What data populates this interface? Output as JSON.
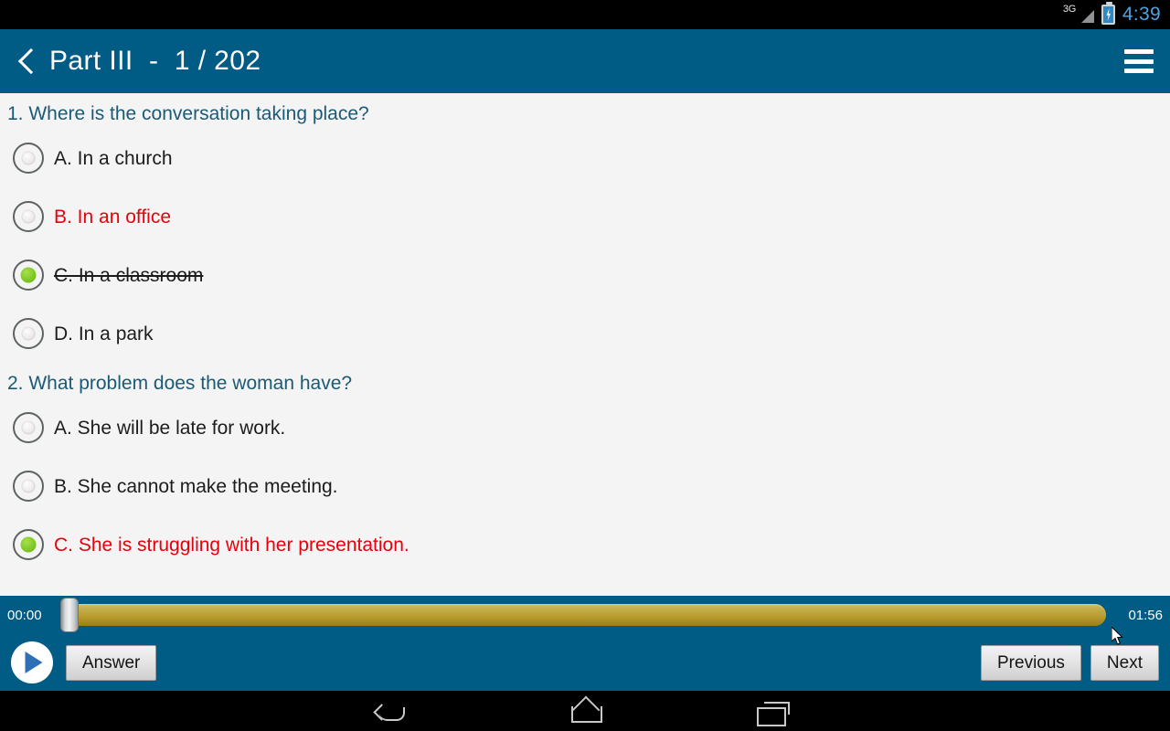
{
  "status_bar": {
    "network_label": "3G",
    "clock": "4:39",
    "battery_state": "charging"
  },
  "header": {
    "back_icon": "chevron-left-icon",
    "title": "Part III  -  1 / 202",
    "menu_icon": "hamburger-menu-icon"
  },
  "questions": [
    {
      "title": "1. Where is the conversation taking place?",
      "options": [
        {
          "text": "A. In a church",
          "selected": false,
          "red": false,
          "strike": false
        },
        {
          "text": "B. In an office",
          "selected": false,
          "red": true,
          "strike": false
        },
        {
          "text": "C. In a classroom",
          "selected": true,
          "red": false,
          "strike": true
        },
        {
          "text": "D. In a park",
          "selected": false,
          "red": false,
          "strike": false
        }
      ]
    },
    {
      "title": "2. What problem does the woman have?",
      "options": [
        {
          "text": "A. She will be late for work.",
          "selected": false,
          "red": false,
          "strike": false
        },
        {
          "text": "B. She cannot make the meeting.",
          "selected": false,
          "red": false,
          "strike": false
        },
        {
          "text": "C. She is struggling with her presentation.",
          "selected": true,
          "red": true,
          "strike": false
        },
        {
          "text": "",
          "selected": false,
          "red": false,
          "strike": false
        }
      ]
    }
  ],
  "player": {
    "current_time": "00:00",
    "total_time": "01:56",
    "progress_percent": 0,
    "play_icon": "play-icon",
    "answer_label": "Answer",
    "previous_label": "Previous",
    "next_label": "Next"
  },
  "nav_bar": {
    "back_icon": "android-back-icon",
    "home_icon": "android-home-icon",
    "recents_icon": "android-recents-icon"
  },
  "colors": {
    "header_blue": "#005b85",
    "question_teal": "#1c5a74",
    "answer_red": "#e8000c",
    "selected_green": "#7cc722",
    "seek_gold": "#b79a2b",
    "page_background": "#f4f4f4"
  }
}
